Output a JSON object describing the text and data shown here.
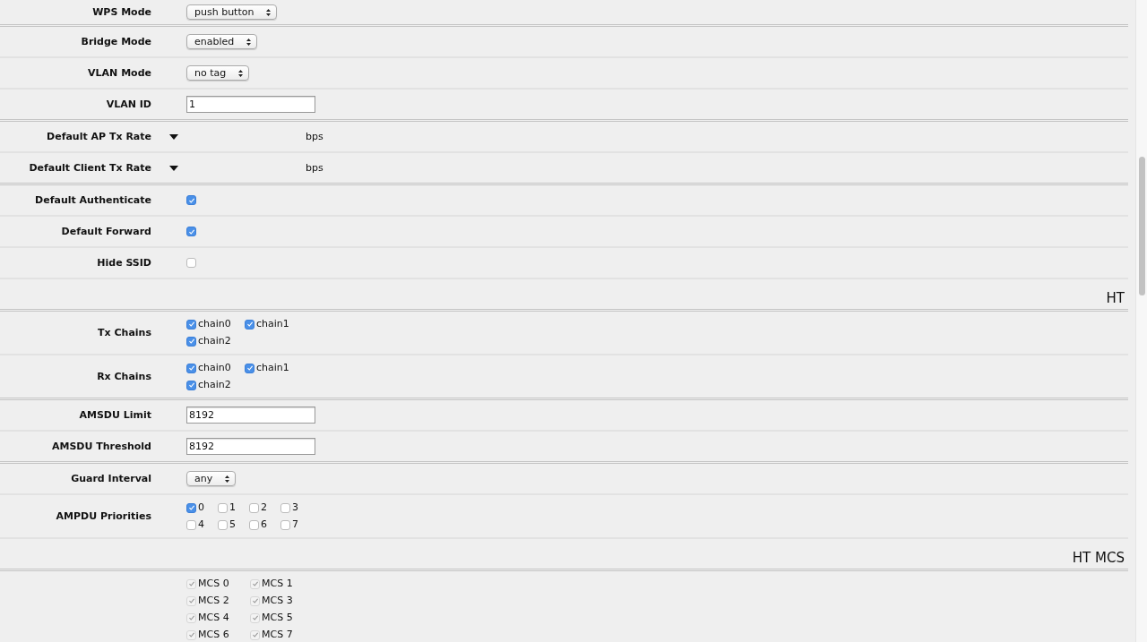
{
  "groups": [
    {
      "rows": [
        {
          "kind": "select",
          "label": "WPS Mode",
          "value": "push button"
        }
      ]
    },
    {
      "rows": [
        {
          "kind": "select",
          "label": "Bridge Mode",
          "value": "enabled"
        },
        {
          "kind": "select",
          "label": "VLAN Mode",
          "value": "no tag"
        },
        {
          "kind": "text",
          "label": "VLAN ID",
          "value": "1"
        }
      ]
    },
    {
      "rows": [
        {
          "kind": "rate",
          "label": "Default AP Tx Rate",
          "unit": "bps"
        },
        {
          "kind": "rate",
          "label": "Default Client Tx Rate",
          "unit": "bps"
        }
      ]
    },
    {
      "rows": [
        {
          "kind": "check",
          "label": "Default Authenticate",
          "checked": true
        },
        {
          "kind": "check",
          "label": "Default Forward",
          "checked": true
        },
        {
          "kind": "check",
          "label": "Hide SSID",
          "checked": false
        },
        {
          "kind": "heading",
          "label": "HT"
        }
      ]
    },
    {
      "rows": [
        {
          "kind": "checkgroup",
          "label": "Tx Chains",
          "lines": [
            [
              {
                "label": "chain0",
                "checked": true,
                "disabled": false
              },
              {
                "label": "chain1",
                "checked": true,
                "disabled": false
              }
            ],
            [
              {
                "label": "chain2",
                "checked": true,
                "disabled": false
              }
            ]
          ]
        },
        {
          "kind": "checkgroup",
          "label": "Rx Chains",
          "lines": [
            [
              {
                "label": "chain0",
                "checked": true,
                "disabled": false
              },
              {
                "label": "chain1",
                "checked": true,
                "disabled": false
              }
            ],
            [
              {
                "label": "chain2",
                "checked": true,
                "disabled": false
              }
            ]
          ]
        }
      ]
    },
    {
      "rows": [
        {
          "kind": "text",
          "label": "AMSDU Limit",
          "value": "8192"
        },
        {
          "kind": "text",
          "label": "AMSDU Threshold",
          "value": "8192"
        }
      ]
    },
    {
      "rows": [
        {
          "kind": "select",
          "label": "Guard Interval",
          "value": "any"
        },
        {
          "kind": "checkgroup",
          "label": "AMPDU Priorities",
          "lines": [
            [
              {
                "label": "0",
                "checked": true,
                "disabled": false
              },
              {
                "label": "1",
                "checked": false,
                "disabled": false
              },
              {
                "label": "2",
                "checked": false,
                "disabled": false
              },
              {
                "label": "3",
                "checked": false,
                "disabled": false
              }
            ],
            [
              {
                "label": "4",
                "checked": false,
                "disabled": false
              },
              {
                "label": "5",
                "checked": false,
                "disabled": false
              },
              {
                "label": "6",
                "checked": false,
                "disabled": false
              },
              {
                "label": "7",
                "checked": false,
                "disabled": false
              }
            ]
          ]
        },
        {
          "kind": "heading",
          "label": "HT MCS"
        }
      ]
    },
    {
      "rows": [
        {
          "kind": "checkgroup",
          "lines": [
            [
              {
                "label": "MCS 0",
                "checked": true,
                "disabled": true
              },
              {
                "label": "MCS 1",
                "checked": true,
                "disabled": true
              }
            ],
            [
              {
                "label": "MCS 2",
                "checked": true,
                "disabled": true
              },
              {
                "label": "MCS 3",
                "checked": true,
                "disabled": true
              }
            ],
            [
              {
                "label": "MCS 4",
                "checked": true,
                "disabled": true
              },
              {
                "label": "MCS 5",
                "checked": true,
                "disabled": true
              }
            ],
            [
              {
                "label": "MCS 6",
                "checked": true,
                "disabled": true
              },
              {
                "label": "MCS 7",
                "checked": true,
                "disabled": true
              }
            ]
          ]
        }
      ]
    }
  ]
}
